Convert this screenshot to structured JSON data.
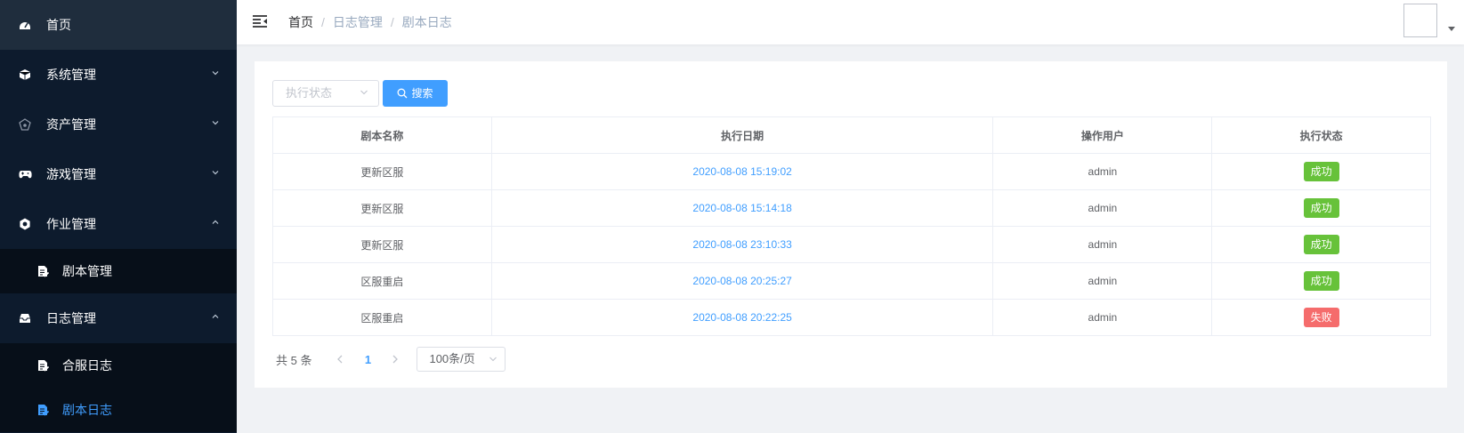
{
  "sidebar": {
    "items": [
      {
        "label": "首页",
        "icon": "dashboard-icon"
      },
      {
        "label": "系统管理",
        "icon": "cube-icon"
      },
      {
        "label": "资产管理",
        "icon": "asset-icon"
      },
      {
        "label": "游戏管理",
        "icon": "gamepad-icon"
      },
      {
        "label": "作业管理",
        "icon": "gear-icon"
      },
      {
        "label": "剧本管理",
        "icon": "document-icon"
      },
      {
        "label": "日志管理",
        "icon": "log-icon"
      },
      {
        "label": "合服日志",
        "icon": "document-icon"
      },
      {
        "label": "剧本日志",
        "icon": "document-icon"
      }
    ]
  },
  "breadcrumb": {
    "home": "首页",
    "sep": "/",
    "level1": "日志管理",
    "level2": "剧本日志"
  },
  "filter": {
    "status_placeholder": "执行状态",
    "search_label": "搜索"
  },
  "table": {
    "headers": [
      "剧本名称",
      "执行日期",
      "操作用户",
      "执行状态"
    ],
    "rows": [
      {
        "name": "更新区服",
        "date": "2020-08-08 15:19:02",
        "user": "admin",
        "status": "成功"
      },
      {
        "name": "更新区服",
        "date": "2020-08-08 15:14:18",
        "user": "admin",
        "status": "成功"
      },
      {
        "name": "更新区服",
        "date": "2020-08-08 23:10:33",
        "user": "admin",
        "status": "成功"
      },
      {
        "name": "区服重启",
        "date": "2020-08-08 20:25:27",
        "user": "admin",
        "status": "成功"
      },
      {
        "name": "区服重启",
        "date": "2020-08-08 20:22:25",
        "user": "admin",
        "status": "失败"
      }
    ]
  },
  "pagination": {
    "total": "共 5 条",
    "current_page": "1",
    "page_size": "100条/页"
  },
  "colors": {
    "accent": "#409eff",
    "success": "#67c23a",
    "danger": "#f56c6c",
    "sidebar": "#0d1b2d"
  }
}
